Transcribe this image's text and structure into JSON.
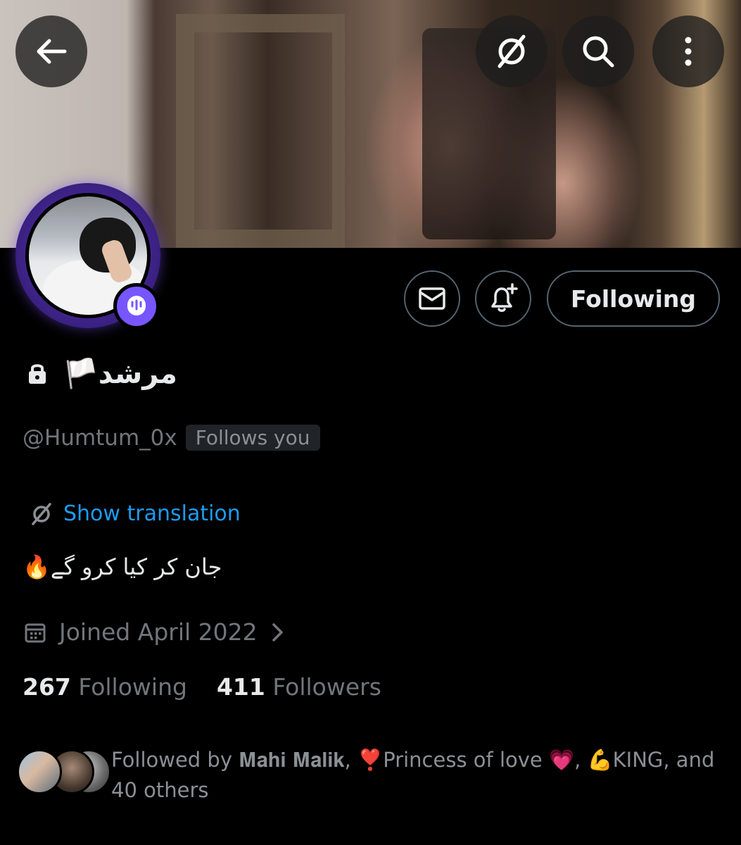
{
  "header": {
    "back_icon": "arrow-left-icon",
    "translate_icon": "translate-icon",
    "search_icon": "search-icon",
    "more_icon": "more-vertical-icon"
  },
  "profile": {
    "display_name": "مرشد🏳️",
    "locked": true,
    "handle": "@Humtum_0x",
    "follows_you_label": "Follows you",
    "show_translation_label": "Show translation",
    "bio": "جان کر کیا کرو گے🔥",
    "joined": "Joined April 2022"
  },
  "actions": {
    "message_icon": "mail-icon",
    "notify_icon": "bell-plus-icon",
    "follow_button_label": "Following"
  },
  "stats": {
    "following_count": "267",
    "following_label": "Following",
    "followers_count": "411",
    "followers_label": "Followers"
  },
  "followed_by": {
    "text": "Followed by 𝐌𝐚𝐡𝐢 𝐌𝐚𝐥𝐢𝐤, ❣️Princess of love 💗, 💪KING, and 40 others"
  },
  "colors": {
    "background": "#000000",
    "primary_text": "#e7e9ea",
    "secondary_text": "#71767b",
    "link": "#1d9bf0",
    "button_border": "#536471",
    "spaces_badge": "#7856ff"
  }
}
